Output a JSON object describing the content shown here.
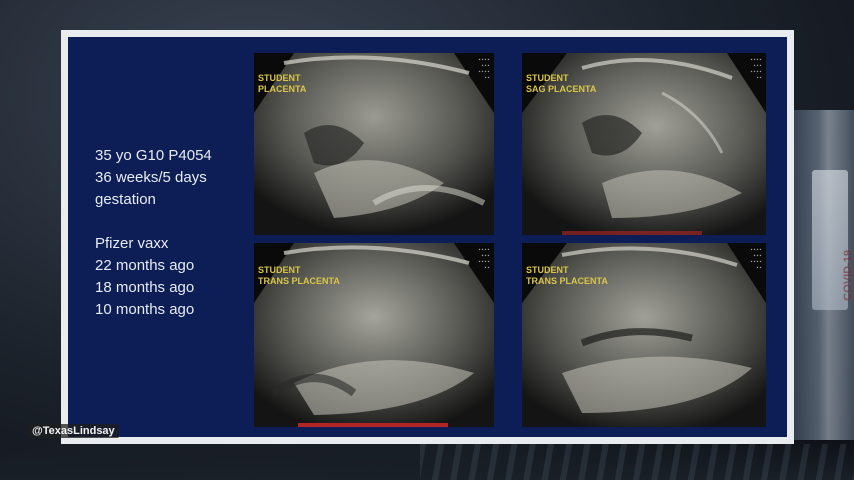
{
  "slide": {
    "text_lines": [
      "35 yo G10 P4054",
      "36 weeks/5 days",
      "gestation"
    ],
    "vaccine_lines": [
      "Pfizer vaxx",
      "22 months ago",
      "18 months ago",
      "10 months ago"
    ]
  },
  "images": [
    {
      "label_1": "STUDENT",
      "label_2": "PLACENTA"
    },
    {
      "label_1": "STUDENT",
      "label_2": "SAG PLACENTA"
    },
    {
      "label_1": "STUDENT",
      "label_2": "TRANS PLACENTA"
    },
    {
      "label_1": "STUDENT",
      "label_2": "TRANS PLACENTA"
    }
  ],
  "watermark": "@TexasLindsay",
  "background_vial_text": "COVID-19",
  "colors": {
    "slide_bg": "#0d1d55",
    "frame": "#e9ecef",
    "label_yellow": "#d9c64a"
  }
}
